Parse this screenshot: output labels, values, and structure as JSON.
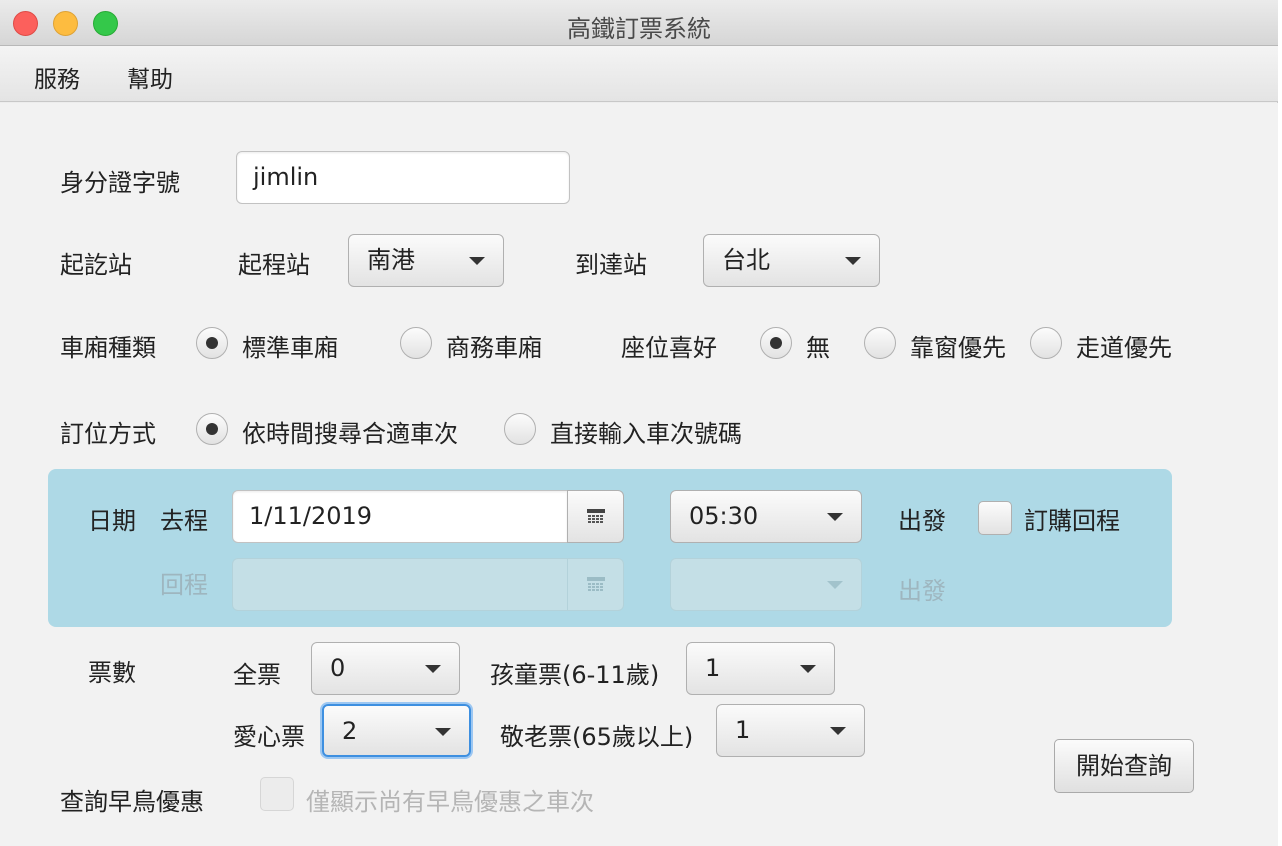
{
  "window": {
    "title": "高鐵訂票系統"
  },
  "menu": {
    "items": [
      "服務",
      "幫助"
    ]
  },
  "form": {
    "id_label": "身分證字號",
    "id_value": "jimlin",
    "station_label": "起訖站",
    "from_label": "起程站",
    "from_value": "南港",
    "to_label": "到達站",
    "to_value": "台北",
    "car_type_label": "車廂種類",
    "car_standard": "標準車廂",
    "car_business": "商務車廂",
    "seat_pref_label": "座位喜好",
    "seat_none": "無",
    "seat_window": "靠窗優先",
    "seat_aisle": "走道優先",
    "booking_method_label": "訂位方式",
    "method_time": "依時間搜尋合適車次",
    "method_train_no": "直接輸入車次號碼",
    "date": {
      "label": "日期",
      "outbound_label": "去程",
      "outbound_date": "1/11/2019",
      "outbound_time": "05:30",
      "depart_label": "出發",
      "return_check_label": "訂購回程",
      "return_label": "回程",
      "return_date": "",
      "return_time": "",
      "return_depart_label": "出發"
    },
    "tickets": {
      "label": "票數",
      "adult_label": "全票",
      "adult_value": "0",
      "child_label": "孩童票(6-11歲)",
      "child_value": "1",
      "disabled_label": "愛心票",
      "disabled_value": "2",
      "senior_label": "敬老票(65歲以上)",
      "senior_value": "1"
    },
    "early_bird_label": "查詢早鳥優惠",
    "early_bird_check": "僅顯示尚有早鳥優惠之車次",
    "search_button": "開始查詢"
  },
  "colors": {
    "date_panel": "#aed9e6",
    "focus_ring": "#3d8fe0"
  }
}
